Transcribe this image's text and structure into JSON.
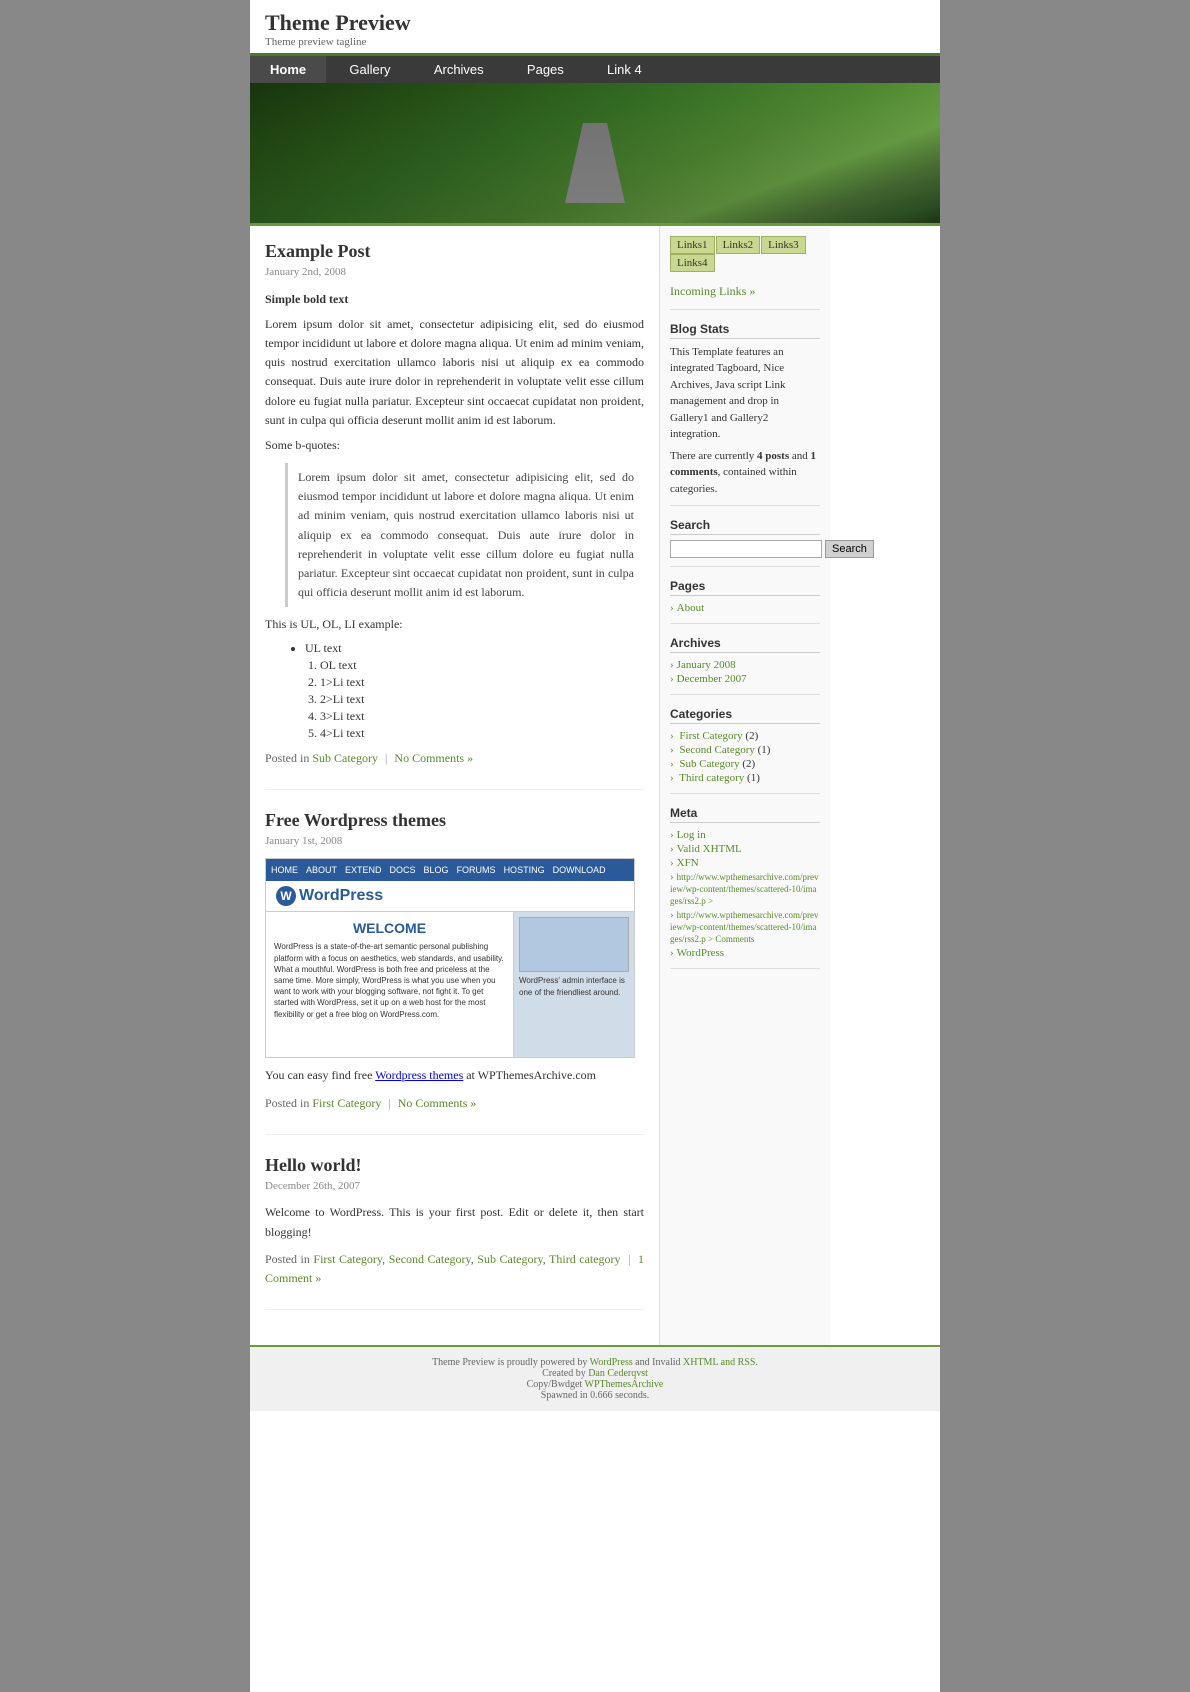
{
  "site": {
    "title": "Theme Preview",
    "tagline": "Theme preview tagline"
  },
  "nav": {
    "items": [
      {
        "label": "Home",
        "active": true
      },
      {
        "label": "Gallery",
        "active": false
      },
      {
        "label": "Archives",
        "active": false
      },
      {
        "label": "Pages",
        "active": false
      },
      {
        "label": "Link 4",
        "active": false
      }
    ]
  },
  "sidebar": {
    "quick_links": {
      "items": [
        "Links1",
        "Links2",
        "Links3",
        "Links4"
      ]
    },
    "incoming_links": {
      "heading": "Incoming Links »"
    },
    "blog_stats": {
      "heading": "Blog Stats",
      "description": "This Template features an integrated Tagboard, Nice Archives, Java script Link management and drop in Gallery1 and Gallery2 integration.",
      "posts_count": "4",
      "comments_count": "1",
      "summary": "There are currently 4 posts and 1 comments, contained within categories."
    },
    "search": {
      "heading": "Search",
      "button_label": "Search",
      "placeholder": ""
    },
    "pages": {
      "heading": "Pages",
      "items": [
        "About"
      ]
    },
    "archives": {
      "heading": "Archives",
      "items": [
        "January 2008",
        "December 2007"
      ]
    },
    "categories": {
      "heading": "Categories",
      "items": [
        {
          "name": "First Category",
          "count": "(2)"
        },
        {
          "name": "Second Category",
          "count": "(1)"
        },
        {
          "name": "Sub Category",
          "count": "(2)"
        },
        {
          "name": "Third category",
          "count": "(1)"
        }
      ]
    },
    "meta": {
      "heading": "Meta",
      "items": [
        "Log in",
        "Valid XHTML",
        "XFN",
        "http://www.wpthemesarchive.com/preview/wp-content/themes/scattered-10/images/rss2.p >",
        "http://www.wpthemesarchive.com/preview/wp-content/themes/scattered-10/images/rss2.p > Comments",
        "WordPress"
      ]
    }
  },
  "posts": [
    {
      "title": "Example Post",
      "date": "January 2nd, 2008",
      "bold_text": "Simple bold text",
      "body": "Lorem ipsum dolor sit amet, consectetur adipisicing elit, sed do eiusmod tempor incididunt ut labore et dolore magna aliqua. Ut enim ad minim veniam, quis nostrud exercitation ullamco laboris nisi ut aliquip ex ea commodo consequat. Duis aute irure dolor in reprehenderit in voluptate velit esse cillum dolore eu fugiat nulla pariatur. Excepteur sint occaecat cupidatat non proident, sunt in culpa qui officia deserunt mollit anim id est laborum.",
      "bquote_label": "Some b-quotes:",
      "blockquote": "Lorem ipsum dolor sit amet, consectetur adipisicing elit, sed do eiusmod tempor incididunt ut labore et dolore magna aliqua. Ut enim ad minim veniam, quis nostrud exercitation ullamco laboris nisi ut aliquip ex ea commodo consequat. Duis aute irure dolor in reprehenderit in voluptate velit esse cillum dolore eu fugiat nulla pariatur. Excepteur sint occaecat cupidatat non proident, sunt in culpa qui officia deserunt mollit anim id est laborum.",
      "list_intro": "This is UL, OL, LI example:",
      "ul_text": "UL text",
      "ol_items": [
        "OL text",
        "1>Li text",
        "2>Li text",
        "3>Li text",
        "4>Li text"
      ],
      "posted_in": "Posted in",
      "category": "Sub Category",
      "comments": "No Comments »"
    },
    {
      "title": "Free Wordpress themes",
      "date": "January 1st, 2008",
      "body_pre": "You can easy find free",
      "link_text": "Wordpress themes",
      "body_post": "at WPThemesArchive.com",
      "posted_in": "Posted in",
      "category": "First Category",
      "comments": "No Comments »"
    },
    {
      "title": "Hello world!",
      "date": "December 26th, 2007",
      "body": "Welcome to WordPress. This is your first post. Edit or delete it, then start blogging!",
      "posted_in": "Posted in",
      "categories": "First Category, Second Category, Sub Category, Third category",
      "comments": "1 Comment »"
    }
  ],
  "footer": {
    "line1_pre": "Theme Preview is proudly powered by",
    "line1_link1": "WordPress",
    "line1_mid": "and Invalid",
    "line1_link2": "XHTML and RSS",
    "line2_pre": "Created by",
    "line2_link": "Dan Cederqvst",
    "line2_post": "",
    "line3_pre": "Copy/Bwdget",
    "line3_link": "WPThemesArchive",
    "line4": "Spawned in 0.666 seconds."
  }
}
